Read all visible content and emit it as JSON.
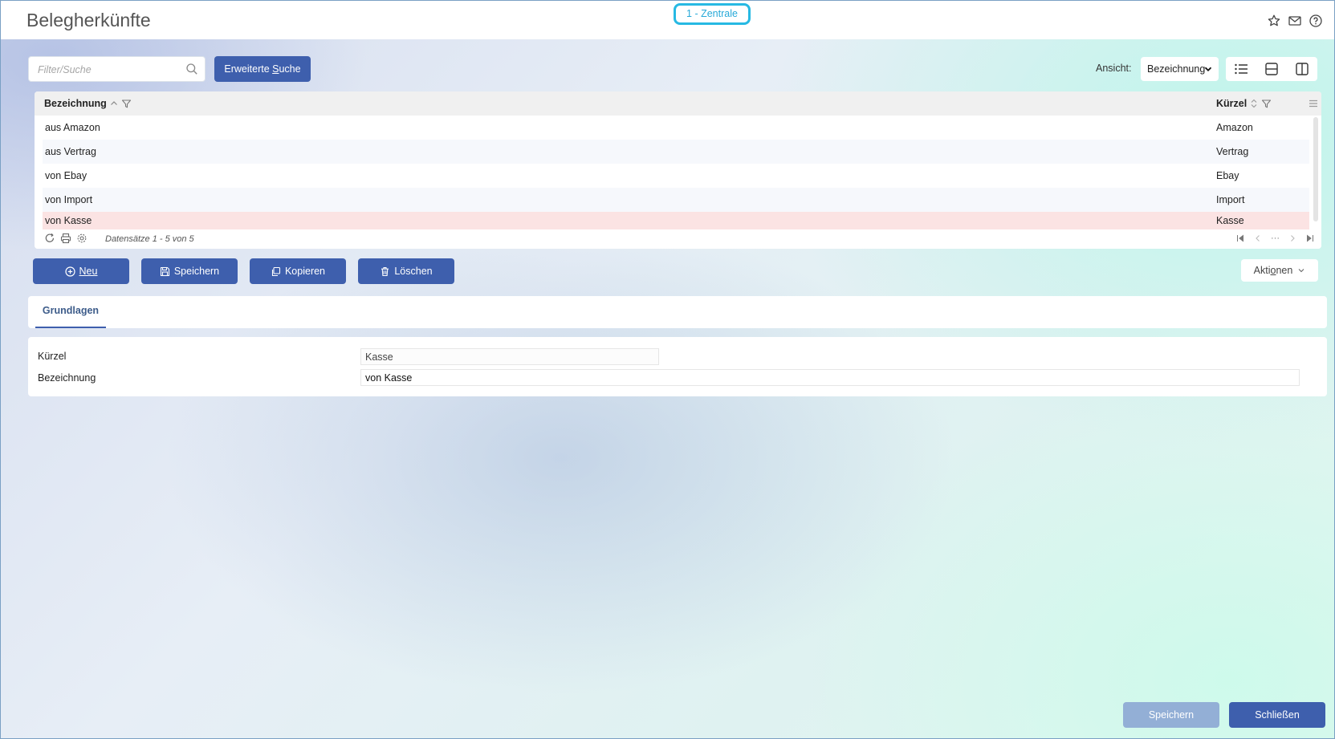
{
  "header": {
    "title": "Belegherkünfte",
    "company": "1 - Zentrale",
    "icons": [
      "star-icon",
      "mail-icon",
      "help-icon"
    ]
  },
  "search": {
    "placeholder": "Filter/Suche",
    "advanced_label_pre": "Erweiterte ",
    "advanced_label_key": "S",
    "advanced_label_post": "uche"
  },
  "view": {
    "label": "Ansicht:",
    "selected": "Bezeichnung"
  },
  "grid": {
    "columns": [
      "Bezeichnung",
      "Kürzel"
    ],
    "rows": [
      {
        "bezeichnung": "aus Amazon",
        "kuerzel": "Amazon"
      },
      {
        "bezeichnung": "aus Vertrag",
        "kuerzel": "Vertrag"
      },
      {
        "bezeichnung": "von Ebay",
        "kuerzel": "Ebay"
      },
      {
        "bezeichnung": "von Import",
        "kuerzel": "Import"
      },
      {
        "bezeichnung": "von Kasse",
        "kuerzel": "Kasse"
      }
    ],
    "selected_row": 4,
    "footer_count": "Datensätze 1 - 5 von 5",
    "pager_ellipsis": "···"
  },
  "actions": {
    "new": "Neu",
    "save": "Speichern",
    "copy": "Kopieren",
    "delete": "Löschen",
    "more_pre": "Akti",
    "more_key": "o",
    "more_post": "nen"
  },
  "tabs": {
    "active": "Grundlagen"
  },
  "form": {
    "kuerzel_label": "Kürzel",
    "kuerzel_value": "Kasse",
    "bezeichnung_label": "Bezeichnung",
    "bezeichnung_value": "von Kasse"
  },
  "footer": {
    "save": "Speichern",
    "close": "Schließen"
  },
  "colors": {
    "primary": "#3e5fad",
    "disabled": "#93afd6",
    "badge": "#27b9e3",
    "selected_row": "#fbe3e3"
  }
}
